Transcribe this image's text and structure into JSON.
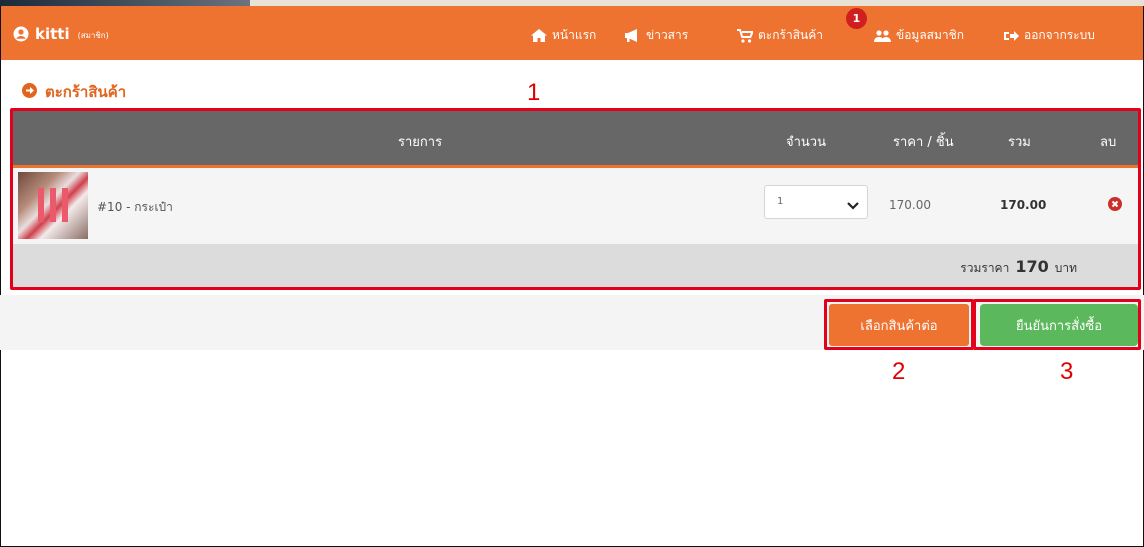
{
  "navbar": {
    "brand_name": "kitti",
    "brand_role": "(สมาชิก)",
    "items": [
      {
        "label": "หน้าแรก",
        "icon": "home-icon"
      },
      {
        "label": "ข่าวสาร",
        "icon": "bullhorn-icon"
      },
      {
        "label": "ตะกร้าสินค้า",
        "icon": "cart-icon",
        "badge": "1"
      },
      {
        "label": "ข้อมูลสมาชิก",
        "icon": "users-icon"
      },
      {
        "label": "ออกจากระบบ",
        "icon": "sign-out-icon"
      }
    ],
    "accent": "#ee7230"
  },
  "page": {
    "title": "ตะกร้าสินค้า"
  },
  "cart": {
    "columns": [
      "รายการ",
      "จำนวน",
      "ราคา / ชิ้น",
      "รวม",
      "ลบ"
    ],
    "rows": [
      {
        "name": "#10 - กระเป๋า",
        "qty": "1",
        "price": "170.00",
        "subtotal": "170.00",
        "image": "bag-thumbnail"
      }
    ],
    "total_label": "รวมราคา",
    "total_value": "170",
    "total_unit": "บาท"
  },
  "actions": {
    "continue_label": "เลือกสินค้าต่อ",
    "confirm_label": "ยืนยันการสั่งซื้อ",
    "continue_color": "#ee7230",
    "confirm_color": "#5cb85c"
  },
  "annotations": {
    "box1": "1",
    "box2": "2",
    "box3": "3",
    "color": "#e2001a"
  }
}
